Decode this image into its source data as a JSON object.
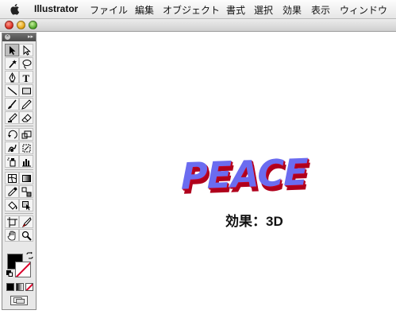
{
  "menubar": {
    "app_name": "Illustrator",
    "items": [
      "ファイル",
      "編集",
      "オブジェクト",
      "書式",
      "選択",
      "効果",
      "表示",
      "ウィンドウ"
    ]
  },
  "toolbar": {
    "tools": [
      "selection-tool",
      "direct-selection-tool",
      "magic-wand-tool",
      "lasso-tool",
      "pen-tool",
      "type-tool",
      "line-tool",
      "rectangle-tool",
      "paintbrush-tool",
      "pencil-tool",
      "blob-brush-tool",
      "eraser-tool",
      "rotate-tool",
      "scale-tool",
      "warp-tool",
      "free-transform-tool",
      "symbol-sprayer-tool",
      "column-graph-tool",
      "mesh-tool",
      "gradient-tool",
      "eyedropper-tool",
      "blend-tool",
      "live-paint-bucket-tool",
      "live-paint-selection-tool",
      "artboard-tool",
      "slice-tool",
      "hand-tool",
      "zoom-tool"
    ],
    "type_tool_glyph": "T",
    "fill_color": "#000000",
    "stroke_color": "#ffffff"
  },
  "artwork": {
    "headline": "PEACE",
    "headline_color": "#6b6cf0",
    "extrude_color": "#b0001c",
    "caption": "効果：3D"
  }
}
